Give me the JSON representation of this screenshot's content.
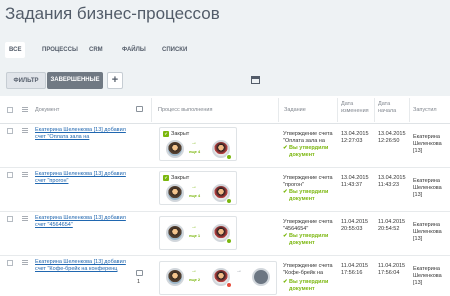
{
  "page": {
    "title": "Задания бизнес-процессов"
  },
  "tabs": [
    {
      "label": "все",
      "active": true
    },
    {
      "label": "процессы"
    },
    {
      "label": "crm"
    },
    {
      "label": "файлы"
    },
    {
      "label": "списки"
    }
  ],
  "toolbar": {
    "filter_label": "ФИЛЬТР",
    "done_label": "ЗАВЕРШЕННЫЕ",
    "plus_label": "+"
  },
  "columns": {
    "document": "Документ",
    "process": "Процесс выполнения",
    "task": "Задание",
    "modified": "Дата изменения",
    "started": "Дата начала",
    "launched_by": "Запустил"
  },
  "rows": [
    {
      "doc": "Екатерина Шеленкова [13] добавил счет \"Оплата зала на",
      "status": "Закрыт",
      "step": "еще 4",
      "task_title": "Утверждение счета \"Оплата зала на",
      "task_result": "Вы утвердили документ",
      "modified": "13.04.2015 12:27:03",
      "started": "13.04.2015 12:26:50",
      "launched_by": "Екатерина Шеленкова [13]"
    },
    {
      "doc": "Екатерина Шеленкова [13] добавил счет \"прогон\"",
      "status": "Закрыт",
      "step": "еще 4",
      "task_title": "Утверждение счета \"прогон\"",
      "task_result": "Вы утвердили документ",
      "modified": "13.04.2015 11:43:37",
      "started": "13.04.2015 11:43:23",
      "launched_by": "Екатерина Шеленкова [13]"
    },
    {
      "doc": "Екатерина Шеленкова [13] добавил счет \"4564654\"",
      "status": "",
      "step": "еще 1",
      "task_title": "Утверждение счета \"4564654\"",
      "task_result": "Вы утвердили документ",
      "modified": "11.04.2015 20:55:03",
      "started": "11.04.2015 20:54:52",
      "launched_by": "Екатерина Шеленкова [13]"
    },
    {
      "doc": "Екатерина Шеленкова [13] добавил счет \"Кофе-брейк на конференц",
      "status": "",
      "step": "еще 2",
      "comments": "1",
      "task_title": "Утверждение счета \"Кофе-брейк на",
      "task_result": "Вы утвердили документ",
      "modified": "11.04.2015 17:56:16",
      "started": "11.04.2015 17:56:04",
      "launched_by": "Екатерина Шеленкова [13]"
    }
  ]
}
